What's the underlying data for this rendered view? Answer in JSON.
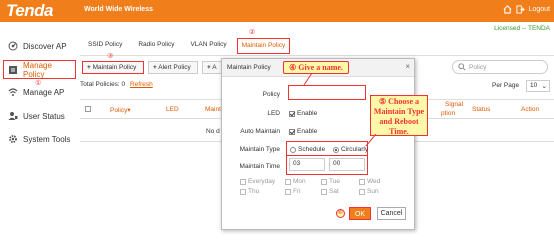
{
  "brand": {
    "logo": "Tenda",
    "tagline": "World Wide Wireless",
    "logout": "Logout"
  },
  "license": "Licensed -- TENDA",
  "sidebar": {
    "items": [
      {
        "label": "Discover AP",
        "icon": "radar-icon"
      },
      {
        "label": "Manage Policy",
        "icon": "policy-icon"
      },
      {
        "label": "Manage AP",
        "icon": "wifi-icon"
      },
      {
        "label": "User Status",
        "icon": "user-icon"
      },
      {
        "label": "System Tools",
        "icon": "gear-icon"
      }
    ]
  },
  "tabs": [
    "SSID Policy",
    "Radio Policy",
    "VLAN Policy",
    "Maintain Policy"
  ],
  "toolbar": {
    "maintain_policy": "Maintain Policy",
    "alert_policy": "Alert Policy",
    "add_partial": "A",
    "search_placeholder": "Policy"
  },
  "summary": {
    "total": "Total Policies: 0",
    "refresh": "Refresh",
    "per_page_label": "Per Page",
    "per_page_value": "10"
  },
  "table": {
    "headers": [
      "Policy",
      "LED",
      "Maint",
      "Signal",
      "ption",
      "Status",
      "Action"
    ],
    "empty": "No d"
  },
  "modal": {
    "title": "Maintain Policy",
    "policy_label": "Policy",
    "policy_value": "",
    "led_label": "LED",
    "led_option": "Enable",
    "auto_label": "Auto Maintain",
    "auto_option": "Enable",
    "type_label": "Maintain Type",
    "type_options": [
      "Schedule",
      "Circularly"
    ],
    "time_label": "Maintain Time",
    "time_hour": "03",
    "time_min": "00",
    "days_row1": [
      "Everyday",
      "Mon",
      "Tue",
      "Wed"
    ],
    "days_row2": [
      "Thu",
      "Fri",
      "Sat",
      "Sun"
    ],
    "ok": "OK",
    "cancel": "Cancel"
  },
  "annotations": {
    "n1": "①",
    "n2": "②",
    "n3": "③",
    "n4": "④",
    "n5": "⑤",
    "n6": "⑥",
    "give_name": "Give a name.",
    "choose_line1": "Choose a",
    "choose_line2": "Maintain Type",
    "choose_line3": "and Reboot",
    "choose_line4": "Time."
  },
  "colors": {
    "brand": "#f07e1b",
    "accent": "#e05a00",
    "annotation": "#e33333",
    "license": "#3a9b2a"
  }
}
